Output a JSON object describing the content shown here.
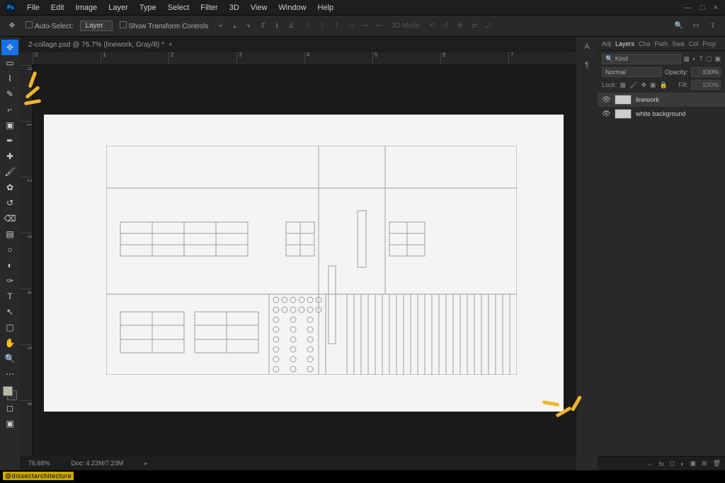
{
  "app_icon": "Ps",
  "menu": [
    "File",
    "Edit",
    "Image",
    "Layer",
    "Type",
    "Select",
    "Filter",
    "3D",
    "View",
    "Window",
    "Help"
  ],
  "win_controls": [
    "—",
    "□",
    "×"
  ],
  "options": {
    "auto_select_label": "Auto-Select:",
    "target": "Layer",
    "show_transform": "Show Transform Controls",
    "mode_3d": "3D Mode"
  },
  "document_tab": "2-collage.psd @ 76.7% (linework, Gray/8) *",
  "ruler_h": [
    "0",
    "1",
    "2",
    "3",
    "4",
    "5",
    "6",
    "7"
  ],
  "ruler_v": [
    "0",
    "1",
    "2",
    "3",
    "4",
    "5",
    "6"
  ],
  "panel_tabs": [
    "Adj",
    "Layers",
    "Cha",
    "Path",
    "Swa",
    "Col",
    "Prop"
  ],
  "layers": {
    "kind_label": "Kind",
    "blend_mode": "Normal",
    "opacity_label": "Opacity:",
    "opacity_value": "100%",
    "lock_label": "Lock:",
    "fill_label": "Fill:",
    "fill_value": "100%",
    "items": [
      {
        "name": "linework"
      },
      {
        "name": "white background"
      }
    ]
  },
  "status": {
    "zoom": "76.68%",
    "doc": "Doc: 4.22M/7.23M"
  },
  "watermark": "@dissectarchitecture"
}
